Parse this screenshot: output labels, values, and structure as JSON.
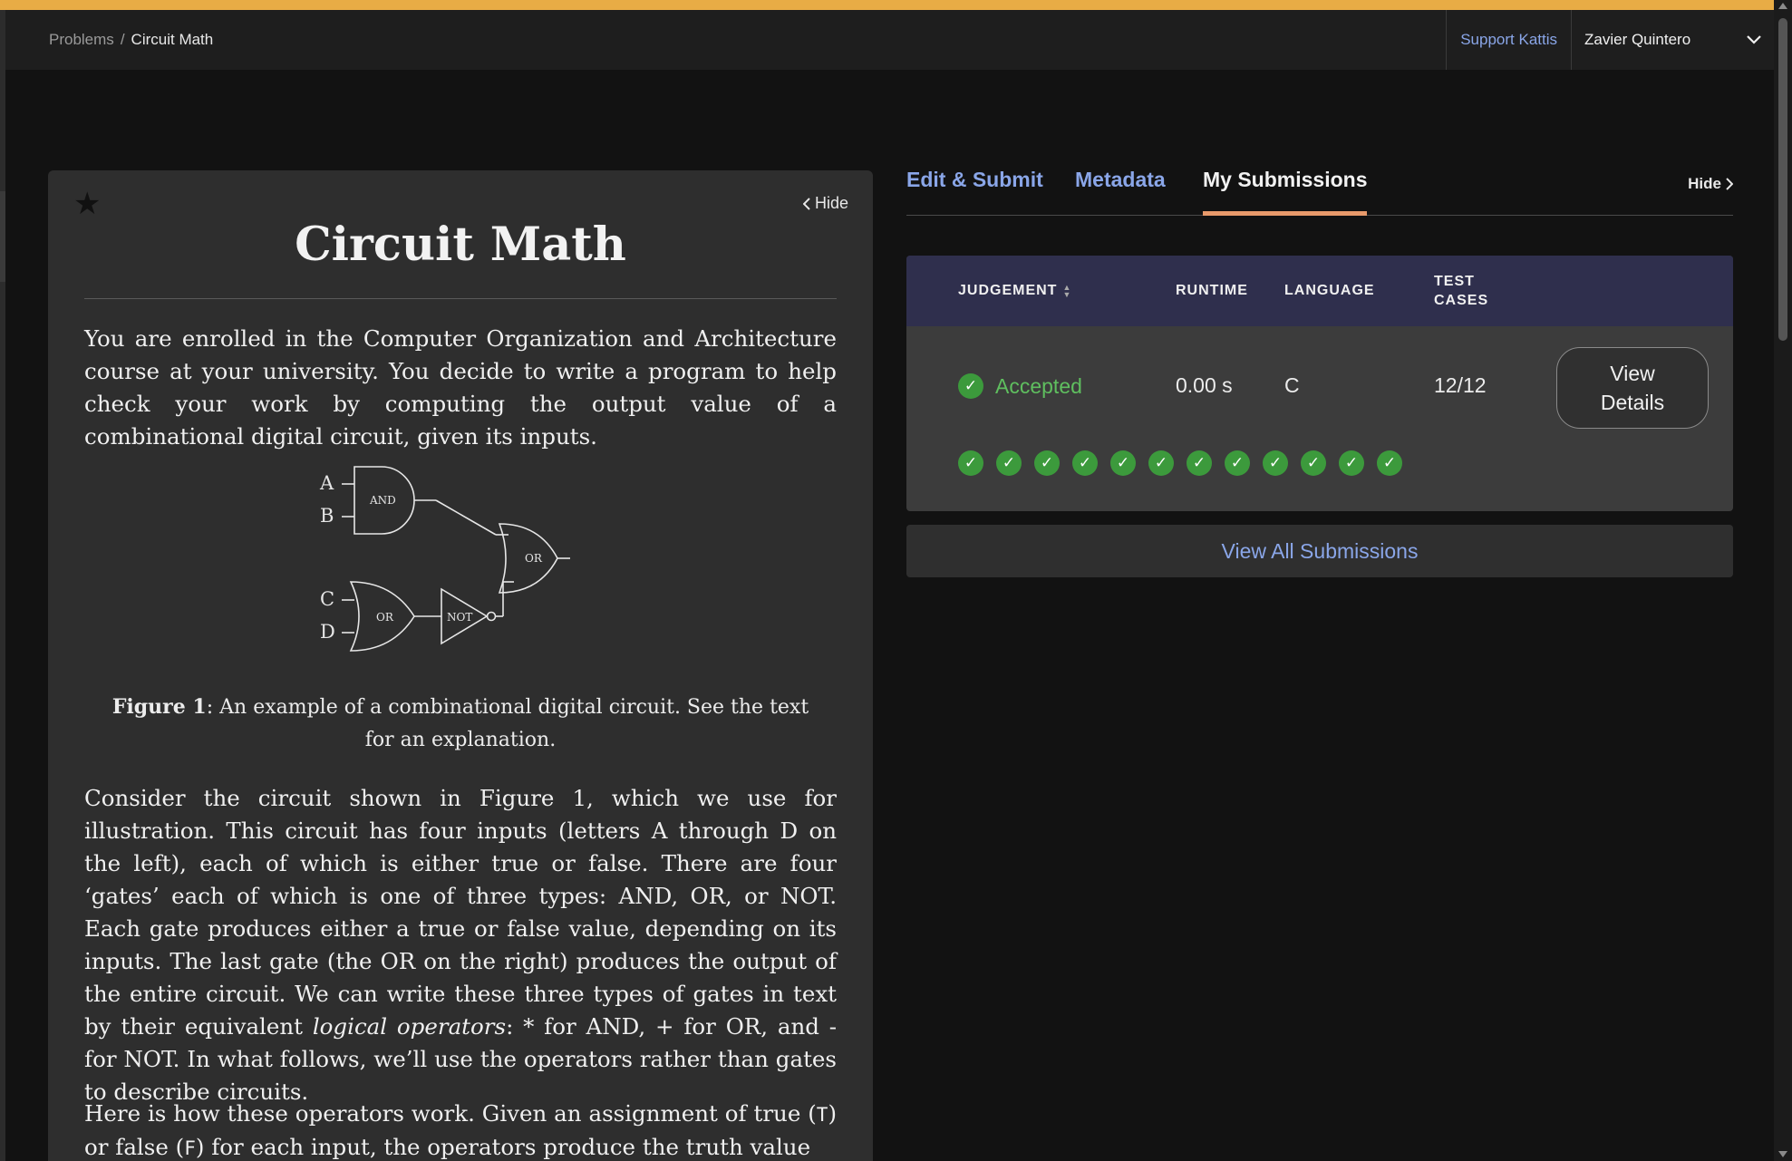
{
  "breadcrumb": {
    "root": "Problems",
    "separator": "/",
    "current": "Circuit Math"
  },
  "header": {
    "support_label": "Support Kattis",
    "user_name": "Zavier Quintero"
  },
  "problem": {
    "hide_label": "Hide",
    "title": "Circuit Math",
    "intro": "You are enrolled in the Computer Organization and Architecture course at your university. You decide to write a program to help check your work by computing the output value of a combinational digital circuit, given its inputs.",
    "figure": {
      "inputs": [
        "A",
        "B",
        "C",
        "D"
      ],
      "gates": [
        "AND",
        "OR",
        "OR",
        "NOT"
      ],
      "caption_label": "Figure 1",
      "caption_text": ": An example of a combinational digital circuit. See the text for an explanation."
    },
    "p2_before": "Consider the circuit shown in Figure 1, which we use for illustration. This circuit has four inputs (letters A through D on the left), each of which is either true or false. There are four ‘gates’ each of which is one of three types: AND, OR, or NOT. Each gate produces either a true or false value, depending on its inputs. The last gate (the OR on the right) produces the output of the entire circuit. We can write these three types of gates in text by their equivalent ",
    "p2_em": "logical operators",
    "p2_after": ": * for AND, + for OR, and - for NOT. In what follows, we’ll use the operators rather than gates to describe circuits.",
    "p3_a": "Here is how these operators work. Given an assignment of true (",
    "p3_t": "T",
    "p3_b": ") or false (",
    "p3_f": "F",
    "p3_c": ") for each input, the operators produce the truth value"
  },
  "tabs": [
    {
      "label": "Edit & Submit",
      "active": false
    },
    {
      "label": "Metadata",
      "active": false
    },
    {
      "label": "My Submissions",
      "active": true
    }
  ],
  "right_hide_label": "Hide",
  "submissions": {
    "headers": {
      "judgement": "JUDGEMENT",
      "runtime": "RUNTIME",
      "language": "LANGUAGE",
      "test_cases_1": "TEST",
      "test_cases_2": "CASES"
    },
    "row": {
      "judgement": "Accepted",
      "runtime": "0.00 s",
      "language": "C",
      "test_cases": "12/12",
      "view_details_1": "View",
      "view_details_2": "Details"
    },
    "passed_test_count": 12
  },
  "view_all_label": "View All Submissions",
  "colors": {
    "accent_bar": "#e8ac45",
    "link": "#8aa6e8",
    "accepted": "#5fbf5f",
    "table_header": "#2f2f4d",
    "active_tab_underline": "#e89a6b"
  }
}
